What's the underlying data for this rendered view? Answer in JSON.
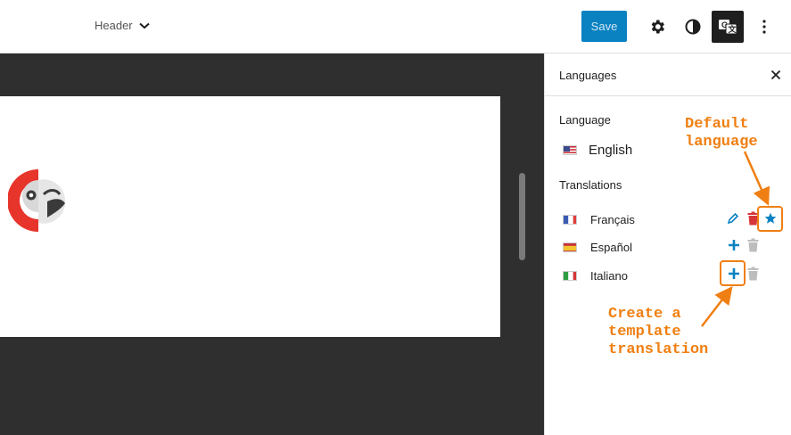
{
  "topbar": {
    "doc_title": "Header",
    "save_label": "Save",
    "colors": {
      "save_bg": "#0a82c2",
      "lang_icon_bg": "#1e1e1e"
    }
  },
  "sidebar": {
    "title": "Languages",
    "language_label": "Language",
    "default_language": {
      "name": "English",
      "flag": "us-flag"
    },
    "translations_label": "Translations",
    "translations": [
      {
        "name": "Français",
        "flag": "fr-flag",
        "actions": [
          "edit-icon",
          "trash-icon",
          "star-icon"
        ]
      },
      {
        "name": "Español",
        "flag": "es-flag",
        "actions": [
          "plus-icon",
          "trash-icon"
        ]
      },
      {
        "name": "Italiano",
        "flag": "it-flag",
        "actions": [
          "plus-icon",
          "trash-icon"
        ]
      }
    ]
  },
  "annotations": {
    "default_language": "Default\nlanguage",
    "create_translation": "Create a\ntemplate\ntranslation",
    "color": "#f07f13"
  }
}
